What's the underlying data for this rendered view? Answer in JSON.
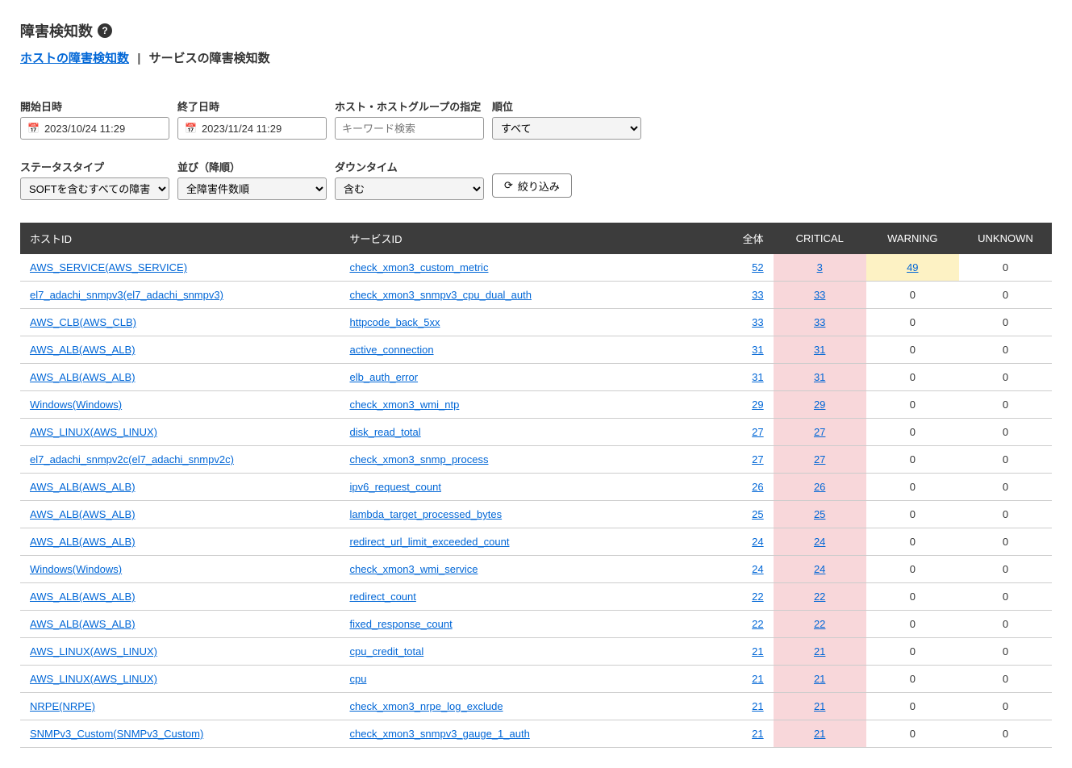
{
  "header": {
    "title": "障害検知数",
    "help": "?"
  },
  "tabs": {
    "host": "ホストの障害検知数",
    "sep": " | ",
    "service": "サービスの障害検知数"
  },
  "filters": {
    "start": {
      "label": "開始日時",
      "value": "2023/10/24 11:29"
    },
    "end": {
      "label": "終了日時",
      "value": "2023/11/24 11:29"
    },
    "host": {
      "label": "ホスト・ホストグループの指定",
      "placeholder": "キーワード検索"
    },
    "rank": {
      "label": "順位",
      "value": "すべて"
    },
    "status": {
      "label": "ステータスタイプ",
      "value": "SOFTを含むすべての障害"
    },
    "sort": {
      "label": "並び（降順）",
      "value": "全障害件数順"
    },
    "downtime": {
      "label": "ダウンタイム",
      "value": "含む"
    },
    "submit": "絞り込み"
  },
  "table": {
    "headers": {
      "host": "ホストID",
      "service": "サービスID",
      "total": "全体",
      "critical": "CRITICAL",
      "warning": "WARNING",
      "unknown": "UNKNOWN"
    },
    "rows": [
      {
        "host": "AWS_SERVICE(AWS_SERVICE)",
        "service": "check_xmon3_custom_metric",
        "total": 52,
        "critical": 3,
        "critical_link": true,
        "warning": 49,
        "warning_link": true,
        "unknown": 0
      },
      {
        "host": "el7_adachi_snmpv3(el7_adachi_snmpv3)",
        "service": "check_xmon3_snmpv3_cpu_dual_auth",
        "total": 33,
        "critical": 33,
        "critical_link": true,
        "warning": 0,
        "unknown": 0
      },
      {
        "host": "AWS_CLB(AWS_CLB)",
        "service": "httpcode_back_5xx",
        "total": 33,
        "critical": 33,
        "critical_link": true,
        "warning": 0,
        "unknown": 0
      },
      {
        "host": "AWS_ALB(AWS_ALB)",
        "service": "active_connection",
        "total": 31,
        "critical": 31,
        "critical_link": true,
        "warning": 0,
        "unknown": 0
      },
      {
        "host": "AWS_ALB(AWS_ALB)",
        "service": "elb_auth_error",
        "total": 31,
        "critical": 31,
        "critical_link": true,
        "warning": 0,
        "unknown": 0
      },
      {
        "host": "Windows(Windows)",
        "service": "check_xmon3_wmi_ntp",
        "total": 29,
        "critical": 29,
        "critical_link": true,
        "warning": 0,
        "unknown": 0
      },
      {
        "host": "AWS_LINUX(AWS_LINUX)",
        "service": "disk_read_total",
        "total": 27,
        "critical": 27,
        "critical_link": true,
        "warning": 0,
        "unknown": 0
      },
      {
        "host": "el7_adachi_snmpv2c(el7_adachi_snmpv2c)",
        "service": "check_xmon3_snmp_process",
        "total": 27,
        "critical": 27,
        "critical_link": true,
        "warning": 0,
        "unknown": 0
      },
      {
        "host": "AWS_ALB(AWS_ALB)",
        "service": "ipv6_request_count",
        "total": 26,
        "critical": 26,
        "critical_link": true,
        "warning": 0,
        "unknown": 0
      },
      {
        "host": "AWS_ALB(AWS_ALB)",
        "service": "lambda_target_processed_bytes",
        "total": 25,
        "critical": 25,
        "critical_link": true,
        "warning": 0,
        "unknown": 0
      },
      {
        "host": "AWS_ALB(AWS_ALB)",
        "service": "redirect_url_limit_exceeded_count",
        "total": 24,
        "critical": 24,
        "critical_link": true,
        "warning": 0,
        "unknown": 0
      },
      {
        "host": "Windows(Windows)",
        "service": "check_xmon3_wmi_service",
        "total": 24,
        "critical": 24,
        "critical_link": true,
        "warning": 0,
        "unknown": 0
      },
      {
        "host": "AWS_ALB(AWS_ALB)",
        "service": "redirect_count",
        "total": 22,
        "critical": 22,
        "critical_link": true,
        "warning": 0,
        "unknown": 0
      },
      {
        "host": "AWS_ALB(AWS_ALB)",
        "service": "fixed_response_count",
        "total": 22,
        "critical": 22,
        "critical_link": true,
        "warning": 0,
        "unknown": 0
      },
      {
        "host": "AWS_LINUX(AWS_LINUX)",
        "service": "cpu_credit_total",
        "total": 21,
        "critical": 21,
        "critical_link": true,
        "warning": 0,
        "unknown": 0
      },
      {
        "host": "AWS_LINUX(AWS_LINUX)",
        "service": "cpu",
        "total": 21,
        "critical": 21,
        "critical_link": true,
        "warning": 0,
        "unknown": 0
      },
      {
        "host": "NRPE(NRPE)",
        "service": "check_xmon3_nrpe_log_exclude",
        "total": 21,
        "critical": 21,
        "critical_link": true,
        "warning": 0,
        "unknown": 0
      },
      {
        "host": "SNMPv3_Custom(SNMPv3_Custom)",
        "service": "check_xmon3_snmpv3_gauge_1_auth",
        "total": 21,
        "critical": 21,
        "critical_link": true,
        "warning": 0,
        "unknown": 0
      }
    ]
  }
}
